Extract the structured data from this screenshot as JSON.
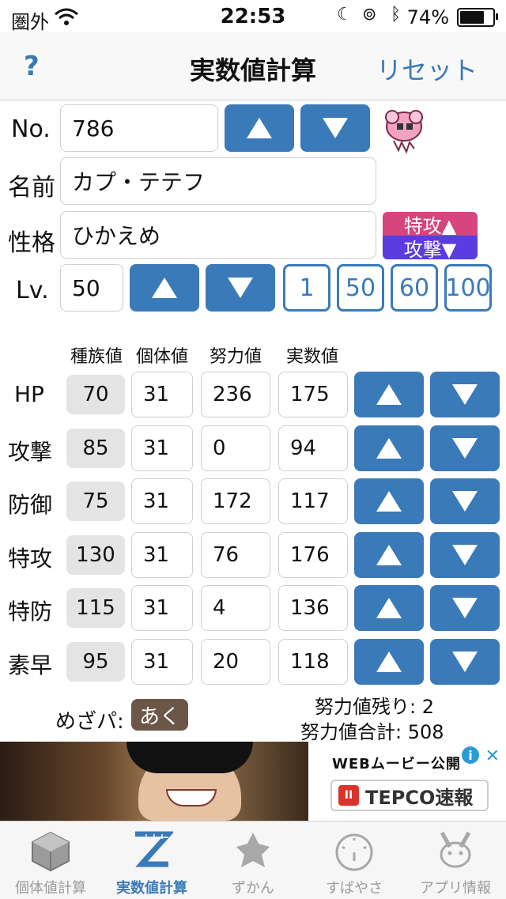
{
  "status_bar": {
    "carrier": "圏外",
    "time": "22:53",
    "battery": "74%",
    "battery_level": 0.74
  },
  "nav": {
    "help": "?",
    "title": "実数値計算",
    "reset": "リセット"
  },
  "form": {
    "no_label": "No.",
    "no_value": "786",
    "name_label": "名前",
    "name_value": "カプ・テテフ",
    "nature_label": "性格",
    "nature_value": "ひかえめ",
    "nature_up": "特攻▲",
    "nature_down": "攻撃▼",
    "lv_label": "Lv.",
    "lv_value": "50",
    "lv_presets": [
      "1",
      "50",
      "60",
      "100"
    ]
  },
  "stats": {
    "headers": [
      "種族値",
      "個体値",
      "努力値",
      "実数値"
    ],
    "rows": [
      {
        "name": "HP",
        "base": "70",
        "iv": "31",
        "ev": "236",
        "actual": "175"
      },
      {
        "name": "攻撃",
        "base": "85",
        "iv": "31",
        "ev": "0",
        "actual": "94"
      },
      {
        "name": "防御",
        "base": "75",
        "iv": "31",
        "ev": "172",
        "actual": "117"
      },
      {
        "name": "特攻",
        "base": "130",
        "iv": "31",
        "ev": "76",
        "actual": "176"
      },
      {
        "name": "特防",
        "base": "115",
        "iv": "31",
        "ev": "4",
        "actual": "136"
      },
      {
        "name": "素早",
        "base": "95",
        "iv": "31",
        "ev": "20",
        "actual": "118"
      }
    ]
  },
  "footer": {
    "hidden_power_label": "めざパ:",
    "hidden_power_value": "あく",
    "ev_remaining": "努力値残り: 2",
    "ev_total": "努力値合計: 508"
  },
  "ad": {
    "headline": "WEBムービー公開",
    "brand": "TEPCO速報",
    "brand_mark": "II"
  },
  "tabs": [
    {
      "label": "個体値計算",
      "icon": "cube-icon"
    },
    {
      "label": "実数値計算",
      "icon": "z-ruler-icon"
    },
    {
      "label": "ずかん",
      "icon": "pokemon-silhouette-icon"
    },
    {
      "label": "すばやさ",
      "icon": "speedometer-icon"
    },
    {
      "label": "アプリ情報",
      "icon": "pikachu-icon"
    }
  ],
  "colors": {
    "accent": "#3b7ab8",
    "nature_up": "#d6457c",
    "nature_down": "#5a3ce0",
    "hidden_power": "#6b5648"
  }
}
